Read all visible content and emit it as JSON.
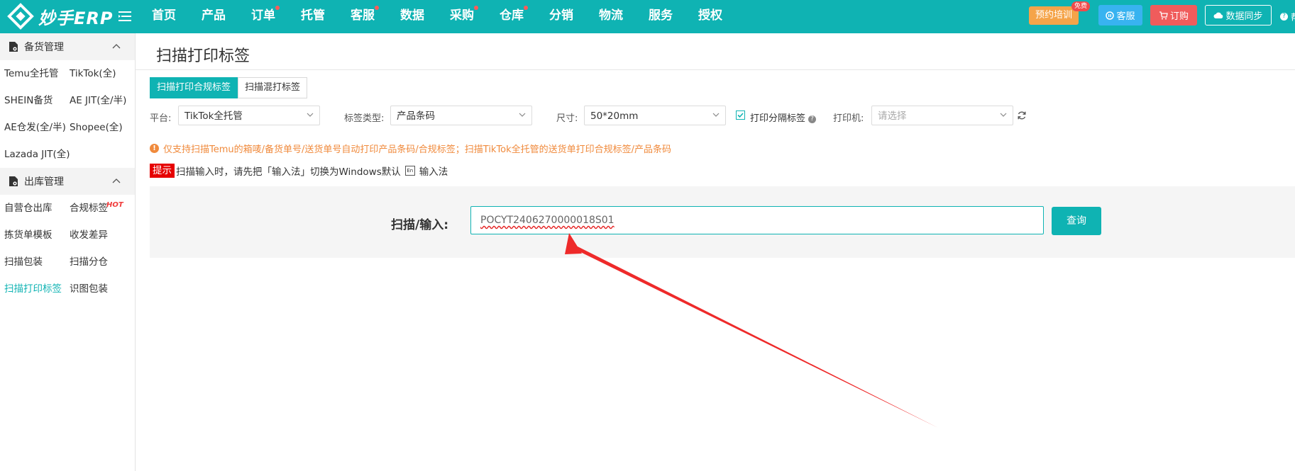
{
  "topbar": {
    "logo_text": "妙手ERP",
    "nav": [
      {
        "label": "首页",
        "dot": false
      },
      {
        "label": "产品",
        "dot": false
      },
      {
        "label": "订单",
        "dot": true
      },
      {
        "label": "托管",
        "dot": false
      },
      {
        "label": "客服",
        "dot": true
      },
      {
        "label": "数据",
        "dot": false
      },
      {
        "label": "采购",
        "dot": true
      },
      {
        "label": "仓库",
        "dot": true
      },
      {
        "label": "分销",
        "dot": false
      },
      {
        "label": "物流",
        "dot": false
      },
      {
        "label": "服务",
        "dot": false
      },
      {
        "label": "授权",
        "dot": false
      }
    ],
    "training_label": "预约培训",
    "free_badge": "免费",
    "service_label": "客服",
    "order_label": "订购",
    "sync_label": "数据同步",
    "help_label": "帮"
  },
  "sidebar": {
    "sections": [
      {
        "title": "备货管理",
        "items": [
          "Temu全托管",
          "TikTok(全)",
          "SHEIN备货",
          "AE JIT(全/半)",
          "AE仓发(全/半)",
          "Shopee(全)",
          "Lazada JIT(全)"
        ]
      },
      {
        "title": "出库管理",
        "items": [
          "自营仓出库",
          "合规标签",
          "拣货单模板",
          "收发差异",
          "扫描包装",
          "扫描分仓",
          "扫描打印标签",
          "识图包装"
        ]
      }
    ],
    "hot_badge": "HOT",
    "active_item": "扫描打印标签"
  },
  "main": {
    "title": "扫描打印标签",
    "tabs": [
      "扫描打印合规标签",
      "扫描混打标签"
    ],
    "filters": {
      "platform_label": "平台:",
      "platform_value": "TikTok全托管",
      "label_type_label": "标签类型:",
      "label_type_value": "产品条码",
      "size_label": "尺寸:",
      "size_value": "50*20mm",
      "print_separator_label": "打印分隔标签",
      "printer_label": "打印机:",
      "printer_placeholder": "请选择"
    },
    "notice": "仅支持扫描Temu的箱唛/备货单号/送货单号自动打印产品条码/合规标签；扫描TikTok全托管的送货单打印合规标签/产品条码",
    "tip_badge": "提示",
    "tip_text": "扫描输入时，请先把「输入法」切换为Windows默认",
    "tip_suffix": "输入法",
    "scan_label": "扫描/输入:",
    "scan_value": "POCYT2406270000018S01",
    "query_button": "查询"
  },
  "colors": {
    "brand": "#0fb3b3",
    "notice": "#f08a3c",
    "tip_badge": "#e60000",
    "arrow": "#ee2a2a"
  }
}
